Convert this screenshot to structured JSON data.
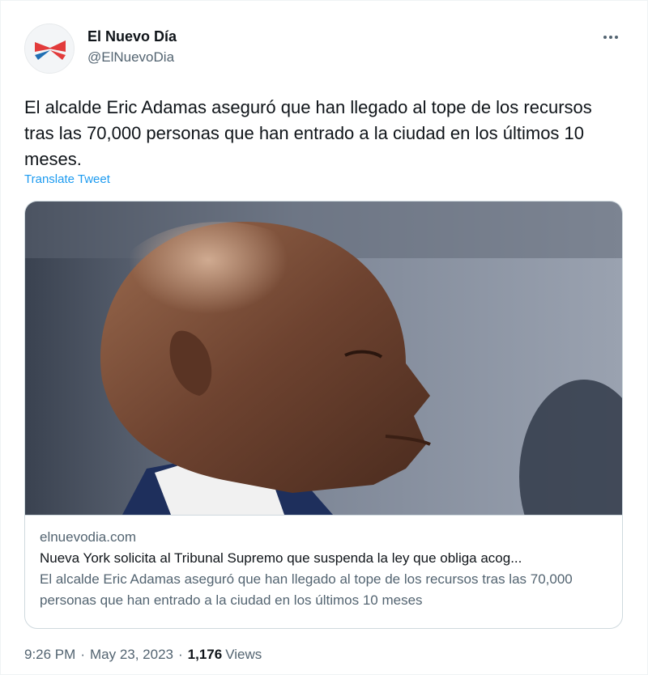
{
  "author": {
    "name": "El Nuevo Día",
    "handle": "@ElNuevoDia",
    "avatar_icon": "el-nuevo-dia-logo",
    "brand_colors": [
      "#e23b3b",
      "#1f6fb3"
    ]
  },
  "tweet": {
    "text": "El alcalde Eric Adamas aseguró que han llegado al tope de los recursos tras las 70,000 personas que han entrado a la ciudad en los últimos 10 meses.",
    "translate_label": "Translate Tweet",
    "more_icon": "more-dots-icon"
  },
  "card": {
    "domain": "elnuevodia.com",
    "title": "Nueva York solicita al Tribunal Supremo que suspenda la ley que obliga acog...",
    "description": "El alcalde Eric Adamas aseguró que han llegado al tope de los recursos tras las 70,000 personas que han entrado a la ciudad en los últimos 10 meses"
  },
  "meta": {
    "time": "9:26 PM",
    "separator": "·",
    "date": "May 23, 2023",
    "views_count": "1,176",
    "views_label": "Views"
  },
  "colors": {
    "text_primary": "#0f1419",
    "text_secondary": "#536471",
    "link": "#1d9bf0",
    "border": "#cfd9de"
  }
}
